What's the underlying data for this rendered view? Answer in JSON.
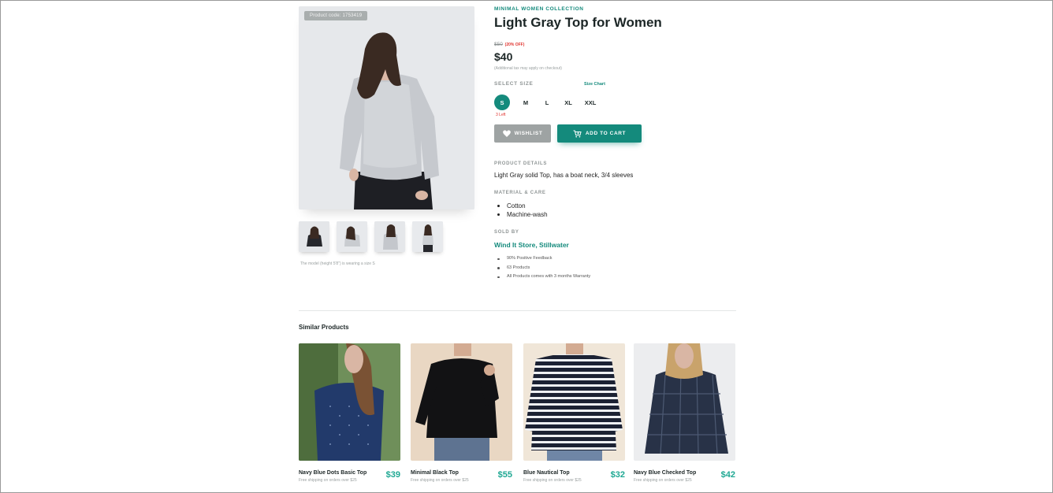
{
  "product": {
    "code_badge": "Product code: 1753419",
    "collection": "MINIMAL WOMEN COLLECTION",
    "title": "Light Gray Top for Women",
    "old_price": "$50",
    "discount": "(20% OFF)",
    "price": "$40",
    "tax_note": "(Additional tax may apply on checkout)",
    "model_note": "The model (height 5'8\") is wearing a size S"
  },
  "size": {
    "label": "SELECT SIZE",
    "chart_link": "Size Chart",
    "options": [
      "S",
      "M",
      "L",
      "XL",
      "XXL"
    ],
    "selected": "S",
    "stock_note": "3 Left"
  },
  "actions": {
    "wishlist_label": "WISHLIST",
    "cart_label": "ADD TO CART"
  },
  "details": {
    "label": "PRODUCT DETAILS",
    "text": "Light Gray solid Top, has a boat neck, 3/4 sleeves"
  },
  "care": {
    "label": "MATERIAL & CARE",
    "items": [
      "Cotton",
      "Machine-wash"
    ]
  },
  "seller": {
    "label": "SOLD BY",
    "name": "Wind It Store, Stillwater",
    "facts": [
      "90% Positive Feedback",
      "63 Products",
      "All Products comes with 3 months Warranty"
    ]
  },
  "similar": {
    "title": "Similar Products",
    "items": [
      {
        "name": "Navy Blue Dots Basic Top",
        "shipping": "Free shipping on orders over $25",
        "price": "$39"
      },
      {
        "name": "Minimal Black Top",
        "shipping": "Free shipping on orders over $25",
        "price": "$55"
      },
      {
        "name": "Blue Nautical Top",
        "shipping": "Free shipping on orders over $25",
        "price": "$32"
      },
      {
        "name": "Navy Blue Checked Top",
        "shipping": "Free shipping on orders over $25",
        "price": "$42"
      }
    ]
  },
  "colors": {
    "accent": "#148a7c",
    "price_accent": "#1fa893",
    "sale_red": "#e0342f",
    "wishlist_gray": "#9ea3a3"
  },
  "icons": {
    "wishlist": "heart-icon",
    "cart": "cart-icon"
  }
}
